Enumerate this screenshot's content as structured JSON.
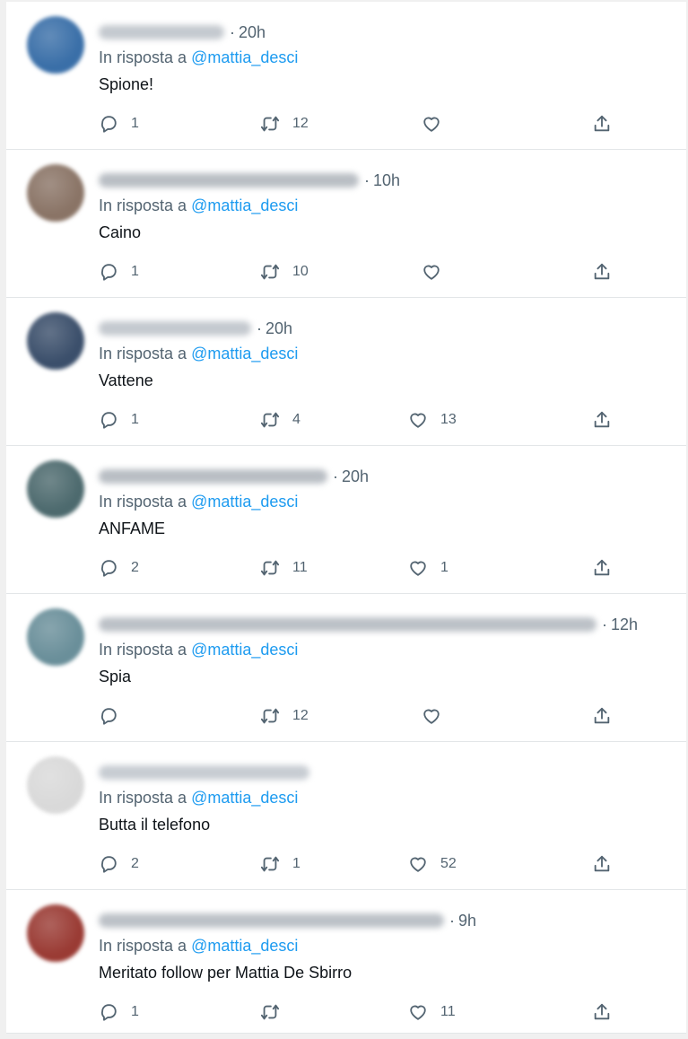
{
  "thread": {
    "replies": [
      {
        "time": "20h",
        "reply_prefix": "In risposta a",
        "mention": "@mattia_desci",
        "text": "Spione!",
        "replies": "1",
        "retweets": "12",
        "likes": "",
        "avatar_color": "#3a6fa8",
        "name_blur_color": "#c4c9cf",
        "name_blur_width": 140
      },
      {
        "time": "10h",
        "reply_prefix": "In risposta a",
        "mention": "@mattia_desci",
        "text": "Caino",
        "replies": "1",
        "retweets": "10",
        "likes": "",
        "avatar_color": "#8a7466",
        "name_blur_color": "#b9bec4",
        "name_blur_width": 290
      },
      {
        "time": "20h",
        "reply_prefix": "In risposta a",
        "mention": "@mattia_desci",
        "text": "Vattene",
        "replies": "1",
        "retweets": "4",
        "likes": "13",
        "avatar_color": "#3b4f6b",
        "name_blur_color": "#c4c9cf",
        "name_blur_width": 170
      },
      {
        "time": "20h",
        "reply_prefix": "In risposta a",
        "mention": "@mattia_desci",
        "text": "ANFAME",
        "replies": "2",
        "retweets": "11",
        "likes": "1",
        "avatar_color": "#4d6a6e",
        "name_blur_color": "#b9bec4",
        "name_blur_width": 255
      },
      {
        "time": "12h",
        "reply_prefix": "In risposta a",
        "mention": "@mattia_desci",
        "text": "Spia",
        "replies": "",
        "retweets": "12",
        "likes": "",
        "avatar_color": "#6a8f9a",
        "name_blur_color": "#bcc1c7",
        "name_blur_width": 555
      },
      {
        "time": "",
        "reply_prefix": "In risposta a",
        "mention": "@mattia_desci",
        "text": "Butta il telefono",
        "replies": "2",
        "retweets": "1",
        "likes": "52",
        "avatar_color": "#d9d9d9",
        "name_blur_color": "#c7ccd2",
        "name_blur_width": 235
      },
      {
        "time": "9h",
        "reply_prefix": "In risposta a",
        "mention": "@mattia_desci",
        "text": "Meritato follow per Mattia De Sbirro",
        "replies": "1",
        "retweets": "",
        "likes": "11",
        "avatar_color": "#9a3b34",
        "name_blur_color": "#bcc1c7",
        "name_blur_width": 385
      }
    ]
  },
  "icons": {
    "reply": "reply-icon",
    "retweet": "retweet-icon",
    "like": "like-icon",
    "share": "share-icon"
  },
  "colors": {
    "mention": "#1d9bf0",
    "secondary_text": "#536471",
    "primary_text": "#0f1419"
  }
}
